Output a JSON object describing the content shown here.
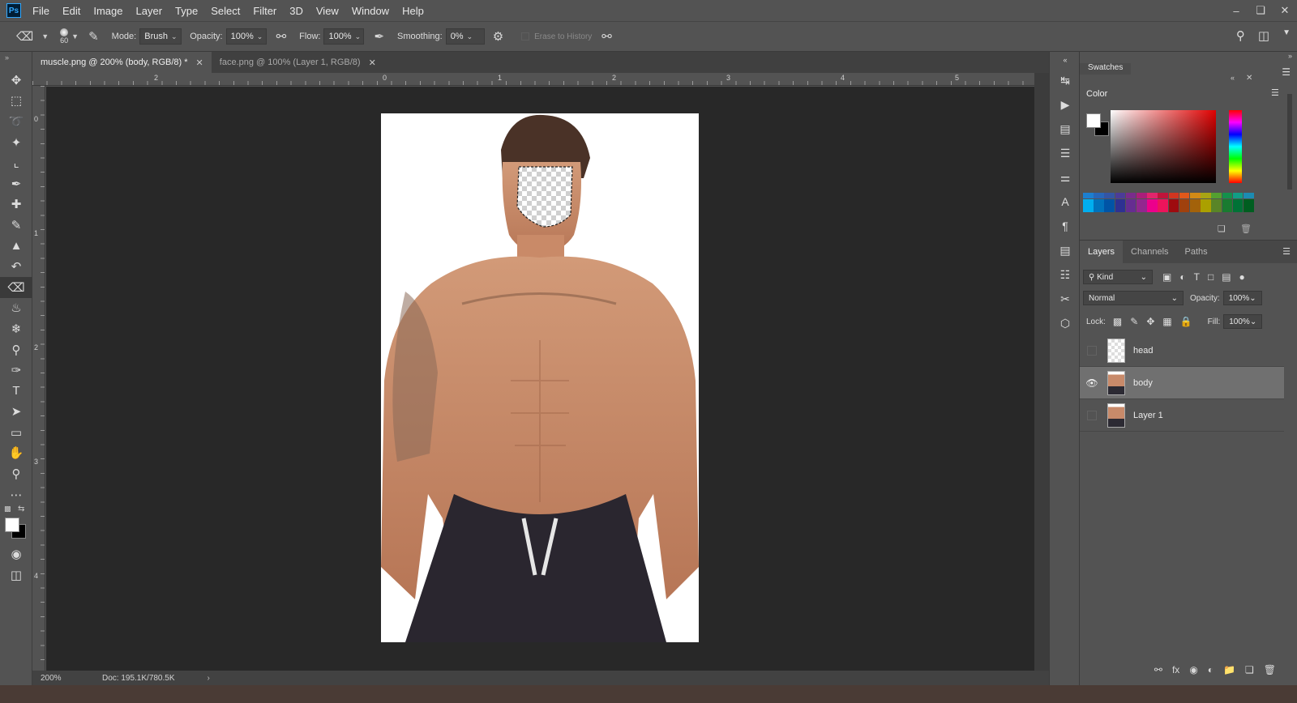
{
  "app": {
    "logo": "Ps"
  },
  "menu": [
    "File",
    "Edit",
    "Image",
    "Layer",
    "Type",
    "Select",
    "Filter",
    "3D",
    "View",
    "Window",
    "Help"
  ],
  "window_controls": [
    "minimize-icon",
    "restore-icon",
    "close-icon"
  ],
  "options": {
    "brush_size": "60",
    "mode_label": "Mode:",
    "mode_value": "Brush",
    "opacity_label": "Opacity:",
    "opacity_value": "100%",
    "flow_label": "Flow:",
    "flow_value": "100%",
    "smoothing_label": "Smoothing:",
    "smoothing_value": "0%",
    "erase_to_history": "Erase to History"
  },
  "tools": [
    "move-icon",
    "marquee-icon",
    "lasso-icon",
    "magic-wand-icon",
    "crop-icon",
    "eyedropper-icon",
    "healing-icon",
    "brush-icon",
    "stamp-icon",
    "history-brush-icon",
    "eraser-icon",
    "paint-bucket-icon",
    "blur-icon",
    "dodge-icon",
    "pen-icon",
    "type-icon",
    "path-select-icon",
    "shape-icon",
    "hand-icon",
    "zoom-icon",
    "more-icon"
  ],
  "colors": {
    "foreground": "#ffffff",
    "background": "#000000",
    "accent": "#31a8ff"
  },
  "document_tabs": [
    {
      "label": "muscle.png @ 200% (body, RGB/8) *",
      "active": true
    },
    {
      "label": "face.png @ 100% (Layer 1, RGB/8)",
      "active": false
    }
  ],
  "ruler": {
    "horizontal": [
      "2",
      "0",
      "1",
      "2",
      "3",
      "4",
      "5"
    ],
    "vertical": [
      "0",
      "1",
      "2",
      "3",
      "4"
    ]
  },
  "status": {
    "zoom": "200%",
    "doc_info": "Doc: 195.1K/780.5K"
  },
  "panels": {
    "swatches_tab": "Swatches",
    "color_title": "Color",
    "layers_tabs": [
      "Layers",
      "Channels",
      "Paths"
    ],
    "filter_kind": "Kind",
    "blend_mode": "Normal",
    "opacity_label": "Opacity:",
    "opacity_value": "100%",
    "lock_label": "Lock:",
    "fill_label": "Fill:",
    "fill_value": "100%"
  },
  "swatches": {
    "row1": [
      "#1c7fd0",
      "#2866b8",
      "#3455a4",
      "#4c3c98",
      "#7a2c8c",
      "#ab1e7a",
      "#e2256c",
      "#c0143a",
      "#d13520",
      "#e0581a",
      "#d28a16",
      "#a8a414",
      "#54a030",
      "#14904c",
      "#109e86",
      "#1c8cb2"
    ],
    "row2": [
      "#00aeef",
      "#0072bc",
      "#0054a6",
      "#2e3192",
      "#662d91",
      "#92278f",
      "#ec008c",
      "#ed145b",
      "#9e0b0f",
      "#a0410d",
      "#a3620a",
      "#aba000",
      "#598527",
      "#197b30",
      "#007236",
      "#005e20"
    ]
  },
  "layers": [
    {
      "name": "head",
      "visible": false,
      "selected": false,
      "thumb": "transparent"
    },
    {
      "name": "body",
      "visible": true,
      "selected": true,
      "thumb": "person"
    },
    {
      "name": "Layer 1",
      "visible": false,
      "selected": false,
      "thumb": "person"
    }
  ],
  "layers_footer_icons": [
    "link-icon",
    "fx-icon",
    "mask-icon",
    "adjustment-icon",
    "group-icon",
    "new-layer-icon",
    "trash-icon"
  ]
}
